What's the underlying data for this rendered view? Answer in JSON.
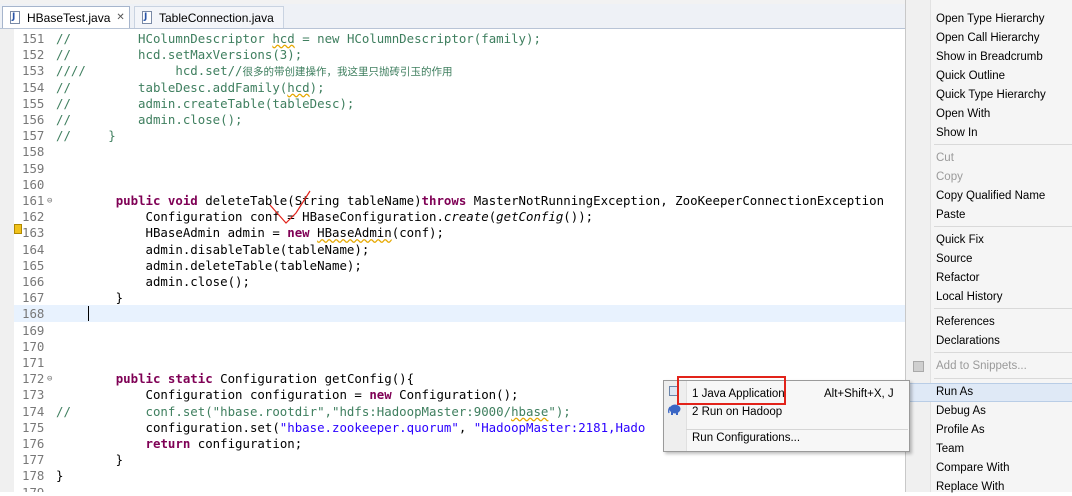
{
  "tabs": [
    {
      "label": "HBaseTest.java",
      "close": "✕"
    },
    {
      "label": "TableConnection.java"
    }
  ],
  "code_lines": [
    {
      "num": "151",
      "segs": [
        {
          "c": "cm",
          "t": "//         HColumnDescriptor "
        },
        {
          "c": "cm squig",
          "t": "hcd"
        },
        {
          "c": "cm",
          "t": " = new HColumnDescriptor(family);"
        }
      ]
    },
    {
      "num": "152",
      "segs": [
        {
          "c": "cm",
          "t": "//         hcd.setMaxVersions(3);"
        }
      ]
    },
    {
      "num": "153",
      "segs": [
        {
          "c": "cm",
          "t": "////            hcd.set//"
        },
        {
          "c": "cm cjk",
          "t": "很多的带创建操作，我这里只抛砖引玉的作用"
        }
      ]
    },
    {
      "num": "154",
      "segs": [
        {
          "c": "cm",
          "t": "//         tableDesc.addFamily("
        },
        {
          "c": "cm squig",
          "t": "hcd"
        },
        {
          "c": "cm",
          "t": ");"
        }
      ]
    },
    {
      "num": "155",
      "segs": [
        {
          "c": "cm",
          "t": "//         admin.createTable(tableDesc);"
        }
      ]
    },
    {
      "num": "156",
      "segs": [
        {
          "c": "cm",
          "t": "//         admin.close();"
        }
      ]
    },
    {
      "num": "157",
      "segs": [
        {
          "c": "cm",
          "t": "//     }"
        }
      ]
    },
    {
      "num": "158",
      "segs": []
    },
    {
      "num": "159",
      "segs": []
    },
    {
      "num": "160",
      "segs": []
    },
    {
      "num": "161",
      "fold": "⊖",
      "segs": [
        {
          "c": "",
          "t": "        "
        },
        {
          "c": "kw",
          "t": "public void"
        },
        {
          "c": "",
          "t": " deleteTable(String tableName)"
        },
        {
          "c": "kw",
          "t": "throws"
        },
        {
          "c": "",
          "t": " MasterNotRunningException, ZooKeeperConnectionException"
        }
      ]
    },
    {
      "num": "162",
      "segs": [
        {
          "c": "",
          "t": "            Configuration conf = HBaseConfiguration."
        },
        {
          "c": "it",
          "t": "create"
        },
        {
          "c": "",
          "t": "("
        },
        {
          "c": "it",
          "t": "getConfig"
        },
        {
          "c": "",
          "t": "());"
        }
      ]
    },
    {
      "num": "163",
      "warn": true,
      "segs": [
        {
          "c": "",
          "t": "            HBaseAdmin admin = "
        },
        {
          "c": "kw",
          "t": "new"
        },
        {
          "c": "",
          "t": " "
        },
        {
          "c": "strike squig",
          "t": "HBaseAdmin"
        },
        {
          "c": "",
          "t": "(conf);"
        }
      ]
    },
    {
      "num": "164",
      "segs": [
        {
          "c": "",
          "t": "            admin.disableTable(tableName);"
        }
      ]
    },
    {
      "num": "165",
      "segs": [
        {
          "c": "",
          "t": "            admin.deleteTable(tableName);"
        }
      ]
    },
    {
      "num": "166",
      "segs": [
        {
          "c": "",
          "t": "            admin.close();"
        }
      ]
    },
    {
      "num": "167",
      "segs": [
        {
          "c": "",
          "t": "        }"
        }
      ]
    },
    {
      "num": "168",
      "segs": []
    },
    {
      "num": "169",
      "segs": []
    },
    {
      "num": "170",
      "segs": []
    },
    {
      "num": "171",
      "segs": []
    },
    {
      "num": "172",
      "fold": "⊖",
      "segs": [
        {
          "c": "",
          "t": "        "
        },
        {
          "c": "kw",
          "t": "public static"
        },
        {
          "c": "",
          "t": " Configuration getConfig(){"
        }
      ]
    },
    {
      "num": "173",
      "segs": [
        {
          "c": "",
          "t": "            Configuration configuration = "
        },
        {
          "c": "kw",
          "t": "new"
        },
        {
          "c": "",
          "t": " Configuration();"
        }
      ]
    },
    {
      "num": "174",
      "segs": [
        {
          "c": "cm",
          "t": "//          conf.set(\"hbase.rootdir\",\"hdfs:HadoopMaster:9000/"
        },
        {
          "c": "cm squig",
          "t": "hbase"
        },
        {
          "c": "cm",
          "t": "\");"
        }
      ]
    },
    {
      "num": "175",
      "segs": [
        {
          "c": "",
          "t": "            configuration.set("
        },
        {
          "c": "st",
          "t": "\"hbase.zookeeper.quorum\""
        },
        {
          "c": "",
          "t": ", "
        },
        {
          "c": "st",
          "t": "\"HadoopMaster:2181,Hado"
        }
      ]
    },
    {
      "num": "176",
      "segs": [
        {
          "c": "",
          "t": "            "
        },
        {
          "c": "kw",
          "t": "return"
        },
        {
          "c": "",
          "t": " configuration;"
        }
      ]
    },
    {
      "num": "177",
      "segs": [
        {
          "c": "",
          "t": "        }"
        }
      ]
    },
    {
      "num": "178",
      "segs": [
        {
          "c": "",
          "t": "}"
        }
      ]
    },
    {
      "num": "179",
      "segs": []
    }
  ],
  "context_menu": {
    "items": [
      {
        "label": "Open Type Hierarchy",
        "disabled": false
      },
      {
        "label": "Open Call Hierarchy",
        "disabled": false
      },
      {
        "label": "Show in Breadcrumb",
        "disabled": false
      },
      {
        "label": "Quick Outline",
        "disabled": false
      },
      {
        "label": "Quick Type Hierarchy",
        "disabled": false
      },
      {
        "label": "Open With",
        "disabled": false,
        "submenu": true
      },
      {
        "label": "Show In",
        "disabled": false,
        "submenu": true
      },
      {
        "label": "Cut",
        "disabled": true
      },
      {
        "label": "Copy",
        "disabled": true
      },
      {
        "label": "Copy Qualified Name",
        "disabled": false
      },
      {
        "label": "Paste",
        "disabled": false
      },
      {
        "label": "Quick Fix",
        "disabled": false
      },
      {
        "label": "Source",
        "disabled": false,
        "submenu": true
      },
      {
        "label": "Refactor",
        "disabled": false,
        "submenu": true
      },
      {
        "label": "Local History",
        "disabled": false,
        "submenu": true
      },
      {
        "label": "References",
        "disabled": false,
        "submenu": true
      },
      {
        "label": "Declarations",
        "disabled": false,
        "submenu": true
      },
      {
        "label": "Add to Snippets...",
        "disabled": true
      },
      {
        "label": "Run As",
        "disabled": false,
        "submenu": true,
        "highlighted": true
      },
      {
        "label": "Debug As",
        "disabled": false,
        "submenu": true
      },
      {
        "label": "Profile As",
        "disabled": false,
        "submenu": true
      },
      {
        "label": "Team",
        "disabled": false,
        "submenu": true
      },
      {
        "label": "Compare With",
        "disabled": false,
        "submenu": true
      },
      {
        "label": "Replace With",
        "disabled": false,
        "submenu": true
      }
    ],
    "submenu_arrow": "▶"
  },
  "run_as_submenu": {
    "items": [
      {
        "label": "1 Java Application",
        "shortcut": "Alt+Shift+X, J",
        "icon": "java-app-icon",
        "highlighted": true
      },
      {
        "label": "2 Run on Hadoop",
        "shortcut": "",
        "icon": "hadoop-elephant-icon"
      },
      {
        "label": "Run Configurations...",
        "shortcut": ""
      }
    ]
  },
  "colors": {
    "keyword": "#7f0055",
    "comment": "#3f7f5f",
    "string": "#2a00ff",
    "annotation_red": "#e2231a",
    "current_line": "#e8f2fe"
  }
}
